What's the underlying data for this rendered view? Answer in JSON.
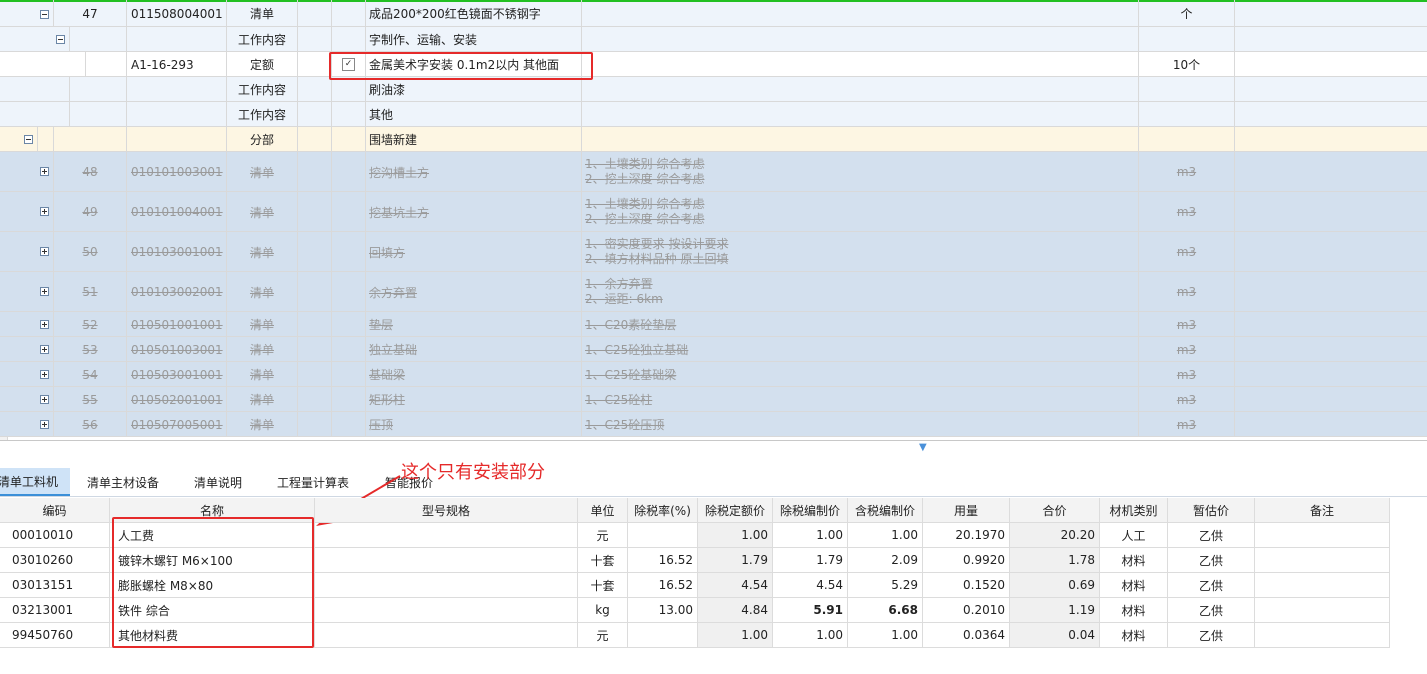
{
  "tree": {
    "rows": [
      {
        "kind": "qingdan",
        "num": "47",
        "code": "011508004001",
        "type": "清单",
        "name": "成品200*200红色镜面不锈钢字",
        "spec": "",
        "unit": "个"
      },
      {
        "kind": "work",
        "type": "工作内容",
        "name": "字制作、运输、安装"
      },
      {
        "kind": "ding",
        "code": "A1-16-293",
        "type": "定额",
        "name": "金属美术字安装 0.1m2以内 其他面",
        "unit": "10个"
      },
      {
        "kind": "work",
        "type": "工作内容",
        "name": "刷油漆"
      },
      {
        "kind": "work",
        "type": "工作内容",
        "name": "其他"
      },
      {
        "kind": "fenbu",
        "type": "分部",
        "name": "围墙新建"
      },
      {
        "kind": "dis",
        "num": "48",
        "code": "010101003001",
        "type": "清单",
        "name": "挖沟槽土方",
        "spec": [
          "1、土壤类别 综合考虑",
          "2、挖土深度 综合考虑"
        ],
        "unit": "m3"
      },
      {
        "kind": "dis",
        "num": "49",
        "code": "010101004001",
        "type": "清单",
        "name": "挖基坑土方",
        "spec": [
          "1、土壤类别 综合考虑",
          "2、挖土深度 综合考虑"
        ],
        "unit": "m3"
      },
      {
        "kind": "dis",
        "num": "50",
        "code": "010103001001",
        "type": "清单",
        "name": "回填方",
        "spec": [
          "1、密实度要求 按设计要求",
          "2、填方材料品种 原土回填"
        ],
        "unit": "m3"
      },
      {
        "kind": "dis",
        "num": "51",
        "code": "010103002001",
        "type": "清单",
        "name": "余方弃置",
        "spec": [
          "1、余方弃置",
          "2、运距: 6km"
        ],
        "unit": "m3"
      },
      {
        "kind": "dis",
        "num": "52",
        "code": "010501001001",
        "type": "清单",
        "name": "垫层",
        "spec": [
          "1、C20素砼垫层"
        ],
        "unit": "m3"
      },
      {
        "kind": "dis",
        "num": "53",
        "code": "010501003001",
        "type": "清单",
        "name": "独立基础",
        "spec": [
          "1、C25砼独立基础"
        ],
        "unit": "m3"
      },
      {
        "kind": "dis",
        "num": "54",
        "code": "010503001001",
        "type": "清单",
        "name": "基础梁",
        "spec": [
          "1、C25砼基础梁"
        ],
        "unit": "m3"
      },
      {
        "kind": "dis",
        "num": "55",
        "code": "010502001001",
        "type": "清单",
        "name": "矩形柱",
        "spec": [
          "1、C25砼柱"
        ],
        "unit": "m3"
      },
      {
        "kind": "dis",
        "num": "56",
        "code": "010507005001",
        "type": "清单",
        "name": "压顶",
        "spec": [
          "1、C25砼压顶"
        ],
        "unit": "m3"
      }
    ]
  },
  "tabs": [
    "清单工料机",
    "清单主材设备",
    "清单说明",
    "工程量计算表",
    "智能报价"
  ],
  "annotation": "这个只有安装部分",
  "table": {
    "headers": [
      "编码",
      "名称",
      "型号规格",
      "单位",
      "除税率(%)",
      "除税定额价",
      "除税编制价",
      "含税编制价",
      "用量",
      "合价",
      "材机类别",
      "暂估价",
      "备注"
    ],
    "rows": [
      [
        "00010010",
        "人工费",
        "",
        "元",
        "",
        "1.00",
        "1.00",
        "1.00",
        "20.1970",
        "20.20",
        "人工",
        "乙供",
        ""
      ],
      [
        "03010260",
        "镀锌木螺钉 M6×100",
        "",
        "十套",
        "16.52",
        "1.79",
        "1.79",
        "2.09",
        "0.9920",
        "1.78",
        "材料",
        "乙供",
        ""
      ],
      [
        "03013151",
        "膨胀螺栓 M8×80",
        "",
        "十套",
        "16.52",
        "4.54",
        "4.54",
        "5.29",
        "0.1520",
        "0.69",
        "材料",
        "乙供",
        ""
      ],
      [
        "03213001",
        "铁件 综合",
        "",
        "kg",
        "13.00",
        "4.84",
        "5.91",
        "6.68",
        "0.2010",
        "1.19",
        "材料",
        "乙供",
        ""
      ],
      [
        "99450760",
        "其他材料费",
        "",
        "元",
        "",
        "1.00",
        "1.00",
        "1.00",
        "0.0364",
        "0.04",
        "材料",
        "乙供",
        ""
      ]
    ]
  },
  "colors": {
    "accent": "#3b8fd8",
    "annotation": "#e52a2a",
    "selected_border": "#22c022",
    "disabled_bg": "#d3e0ee"
  }
}
